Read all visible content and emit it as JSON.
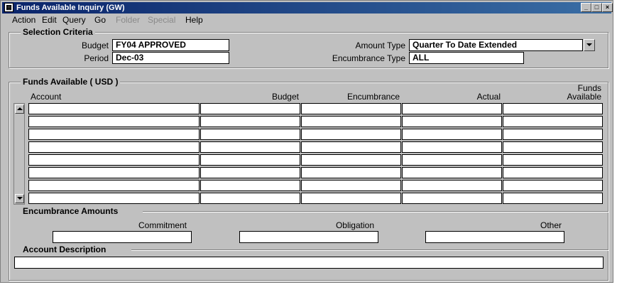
{
  "window": {
    "title": "Funds Available Inquiry (GW)",
    "controls": [
      "minimize-icon",
      "maximize-icon",
      "close-icon"
    ]
  },
  "menu": {
    "items": [
      {
        "label": "Action",
        "enabled": true
      },
      {
        "label": "Edit",
        "enabled": true
      },
      {
        "label": "Query",
        "enabled": true
      },
      {
        "label": "Go",
        "enabled": true
      },
      {
        "label": "Folder",
        "enabled": false
      },
      {
        "label": "Special",
        "enabled": false
      },
      {
        "label": "Help",
        "enabled": true
      }
    ]
  },
  "selection": {
    "title": "Selection Criteria",
    "budget_label": "Budget",
    "budget_value": "FY04 APPROVED",
    "period_label": "Period",
    "period_value": "Dec-03",
    "amount_type_label": "Amount Type",
    "amount_type_value": "Quarter To Date Extended",
    "encumbrance_type_label": "Encumbrance Type",
    "encumbrance_type_value": "ALL"
  },
  "funds": {
    "title": "Funds Available ( USD )",
    "columns": [
      "Account",
      "Budget",
      "Encumbrance",
      "Actual",
      "Funds",
      "Available"
    ],
    "row_count": 8
  },
  "encumbrance": {
    "title": "Encumbrance Amounts",
    "commitment_label": "Commitment",
    "obligation_label": "Obligation",
    "other_label": "Other"
  },
  "description": {
    "title": "Account Description"
  },
  "colors": {
    "window_bg": "#c0c0c0",
    "title_start": "#0a246a",
    "title_end": "#3a6ea5",
    "field_bg": "#ffffff"
  }
}
